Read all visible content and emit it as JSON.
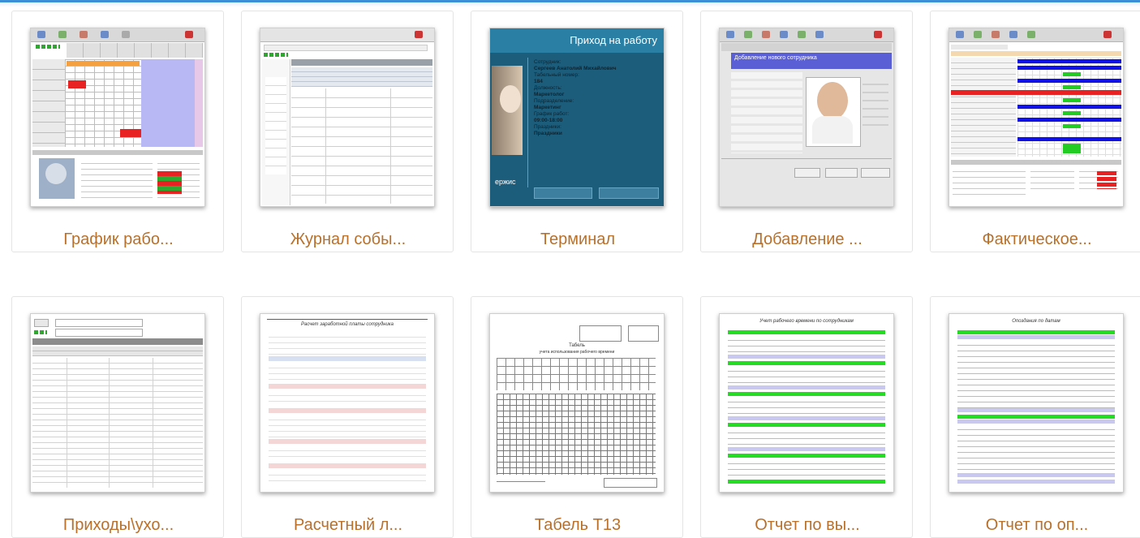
{
  "gallery": {
    "items": [
      {
        "caption": "График рабо..."
      },
      {
        "caption": "Журнал собы..."
      },
      {
        "caption": "Терминал"
      },
      {
        "caption": "Добавление ..."
      },
      {
        "caption": "Фактическое..."
      },
      {
        "caption": "Приходы\\ухо..."
      },
      {
        "caption": "Расчетный л..."
      },
      {
        "caption": "Табель Т13"
      },
      {
        "caption": "Отчет по вы..."
      },
      {
        "caption": "Отчет по оп..."
      }
    ]
  },
  "terminal_thumb": {
    "title": "Приход на работу",
    "lines": [
      "Сотрудник:",
      "Сергеев Анатолий Михайлович",
      "Табельный номер:",
      "184",
      "Должность:",
      "Маркетолог",
      "Подразделение:",
      "Маркетинг",
      "График работ:",
      "09:00-18:00",
      "Праздники:",
      "Праздники"
    ],
    "bottom_text": "ержис"
  },
  "add_employee_thumb": {
    "header": "Добавление нового сотрудника"
  },
  "payslip_thumb": {
    "title": "Расчет заработной платы сотрудника"
  },
  "tabel_thumb": {
    "title": "Табель",
    "subtitle": "учета использования рабочего времени"
  },
  "report_hours_thumb": {
    "title": "Учет рабочего времени по сотрудникам"
  },
  "report_late_thumb": {
    "title": "Опоздания по датам"
  }
}
